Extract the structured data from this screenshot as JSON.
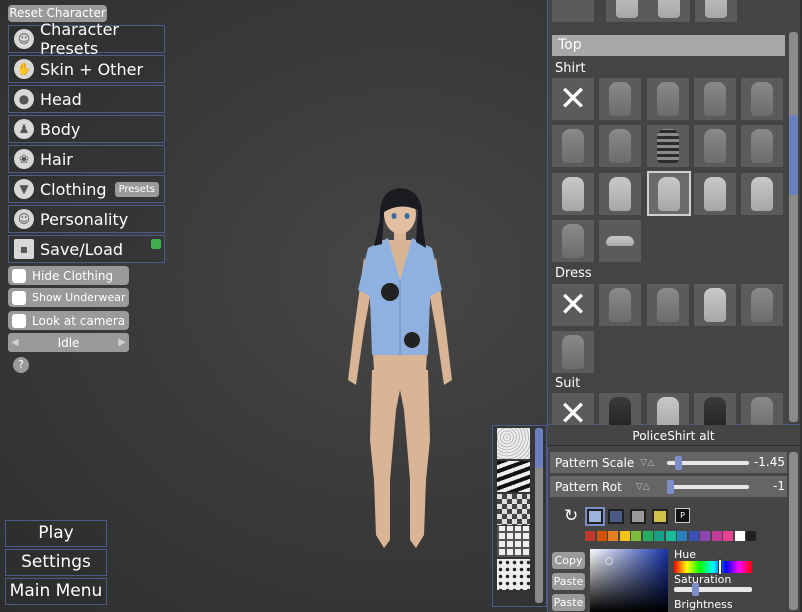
{
  "top": {
    "reset_label": "Reset Character"
  },
  "menu": {
    "items": [
      {
        "label": "Character Presets",
        "icon": "mannequin-icon"
      },
      {
        "label": "Skin + Other",
        "icon": "hand-icon"
      },
      {
        "label": "Head",
        "icon": "head-icon"
      },
      {
        "label": "Body",
        "icon": "body-icon"
      },
      {
        "label": "Hair",
        "icon": "hair-icon"
      },
      {
        "label": "Clothing",
        "icon": "shirt-icon"
      },
      {
        "label": "Personality",
        "icon": "smiley-icon"
      },
      {
        "label": "Save/Load",
        "icon": "floppy-icon"
      }
    ],
    "clothing_presets_label": "Presets"
  },
  "toggles": {
    "hide_clothing": "Hide Clothing",
    "show_underwear": "Show Underwear",
    "look_at_camera": "Look at camera"
  },
  "pose": {
    "value": "Idle"
  },
  "help": {
    "glyph": "?"
  },
  "bottom": {
    "play": "Play",
    "settings": "Settings",
    "main_menu": "Main Menu"
  },
  "clothing_panel": {
    "category": "Top",
    "sections": {
      "shirt": "Shirt",
      "dress": "Dress",
      "suit": "Suit"
    }
  },
  "editor": {
    "title": "PoliceShirt alt",
    "pattern_scale_label": "Pattern Scale",
    "pattern_scale_value": "-1.45",
    "pattern_rot_label": "Pattern Rot",
    "pattern_rot_value": "-1",
    "p_badge": "P",
    "copy": "Copy",
    "paste": "Paste",
    "hue_label": "Hue",
    "saturation_label": "Saturation",
    "brightness_label": "Brightness",
    "slot_colors": [
      "#9cb4dc",
      "#4b5c84",
      "#9a9a9a",
      "#cfc24a"
    ],
    "palette": [
      "#c0392b",
      "#d35400",
      "#e67e22",
      "#f1c40f",
      "#7dbb3a",
      "#27ae60",
      "#16a085",
      "#1abc9c",
      "#2980b9",
      "#3c4fb5",
      "#8e44ad",
      "#c0399b",
      "#e84393",
      "#ffffff",
      "#222222"
    ]
  },
  "colors": {
    "accent_border": "#4d5a8e",
    "selected_slot": "#7c8fc9"
  }
}
